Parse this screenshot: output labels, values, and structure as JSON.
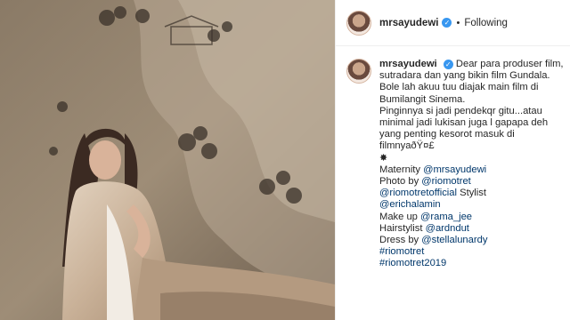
{
  "post": {
    "username": "mrsayudewi",
    "follow_status": "Following",
    "separator": "•"
  },
  "caption": {
    "username": "mrsayudewi",
    "text_lines": [
      "Dear para produser film, sutradara dan yang bikin film Gundala.",
      "Bole lah akuu tuu diajak main film di Bumilangit Sinema.",
      "Pinginnya si jadi pendekqr gitu...atau minimal jadi lukisan juga l gapapa deh yang penting kesorot masuk di filmnyaðŸ¤£"
    ],
    "star": "✸",
    "credits": [
      {
        "label": "Maternity ",
        "mention": "@mrsayudewi"
      },
      {
        "label": "Photo by ",
        "mention": "@riomotret"
      },
      {
        "label": "",
        "mention": "@riomotretofficial",
        "suffix": " Stylist"
      },
      {
        "label": "",
        "mention": "@erichalamin"
      },
      {
        "label": "Make up ",
        "mention": "@rama_jee"
      },
      {
        "label": "Hairstylist ",
        "mention": "@ardndut"
      },
      {
        "label": "Dress by ",
        "mention": "@stellalunardy"
      }
    ],
    "hashtags": [
      "#riomotret",
      "#riomotret2019"
    ]
  },
  "colors": {
    "verified_badge": "#3897f0",
    "link": "#00376b"
  }
}
